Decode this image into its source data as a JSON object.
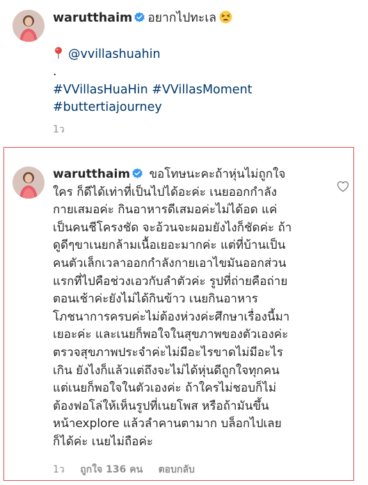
{
  "post": {
    "username": "warutthaim",
    "caption_text": "อยากไปทะเล",
    "location_tag": "@vvillashuahin",
    "dot": ".",
    "hashtags_line1": "#VVillasHuaHin #VVillasMoment",
    "hashtags_line2": "#buttertiajourney",
    "time": "1ว"
  },
  "comment": {
    "username": "warutthaim",
    "lines": [
      "ขอโทษนะคะถ้าหุ่นไม่ถูกใจ",
      "ใคร ก็ดีได้เท่าที่เป็นไปได้อะค่ะ เนยออกกำลัง",
      "กายเสมอค่ะ กินอาหารดีเสมอค่ะไม่ได้อด แค่",
      "เป็นคนชีโครงชัด จะอ้วนจะผอมยังไงก็ชัดค่ะ ถ้า",
      "ดูดีๆขาเนยกล้ามเนื้อเยอะมากค่ะ แต่ที่บ้านเป็น",
      "คนตัวเล็กเวลาออกกำลังกายเอาไขมันออกส่วน",
      "แรกที่ไปคือช่วงเอวกับลำตัวค่ะ รูปที่ถ่ายคือถ่าย",
      "ตอนเช้าค่ะยังไม่ได้กินข้าว เนยกินอาหาร",
      "โภชนาการครบค่ะไม่ต้องห่วงค่ะศึกษาเรื่องนี้มา",
      "เยอะค่ะ และเนยก็พอใจในสุขภาพของตัวเองค่ะ",
      "ตรวจสุขภาพประจำค่ะไม่มีอะไรขาดไม่มีอะไร",
      "เกิน ยังไงก็แล้วแต่ถึงจะไม่ได้หุ่นดีถูกใจทุกคน",
      "แต่เนยก็พอใจในตัวเองค่ะ ถ้าใครไม่ชอบก็ไม่",
      "ต้องฟอโล่ให้เห็นรูปที่เนยโพส หรือถ้ามันขึ้น",
      "หน้าexplore แล้วลำคานตามาก บล็อกไปเลย",
      "ก็ได้ค่ะ เนยไม่ถือค่ะ"
    ],
    "time": "1ว",
    "likes": "ถูกใจ 136 คน",
    "reply": "ตอบกลับ"
  },
  "colors": {
    "text": "#262626",
    "hashtag": "#00376b",
    "secondary": "#8e8e8e",
    "verified": "#3897f0",
    "highlight_border": "#d9534f"
  },
  "icons": [
    "avatar",
    "verified-badge-icon",
    "tired-face-emoji-icon",
    "location-pin-icon",
    "heart-icon"
  ]
}
